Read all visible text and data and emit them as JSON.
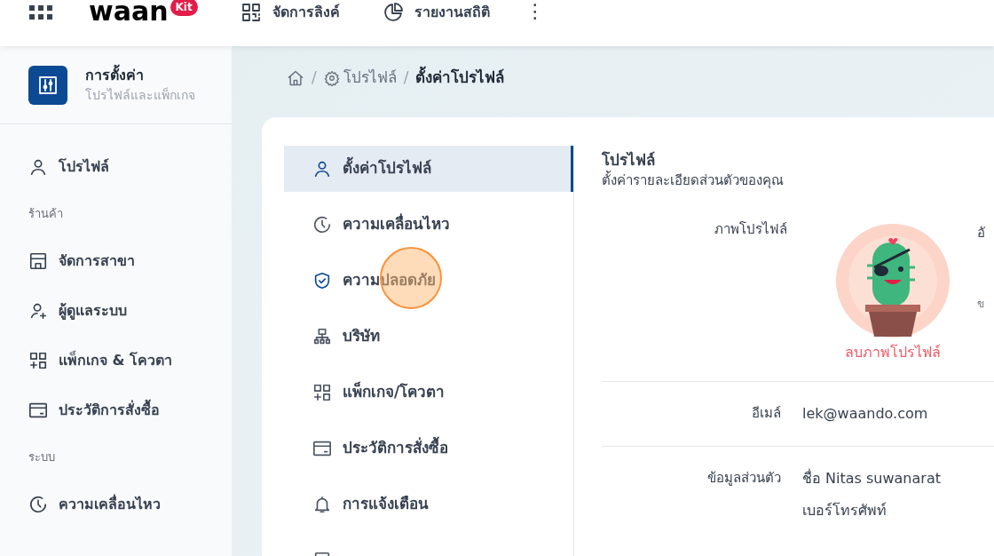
{
  "header": {
    "logo": "waan",
    "logo_badge": "Kit",
    "nav": [
      {
        "label": "จัดการลิงค์",
        "kind": "qr"
      },
      {
        "label": "รายงานสถิติ",
        "kind": "pie"
      }
    ],
    "more": "⋮"
  },
  "sidebar": {
    "title": "การตั้งค่า",
    "subtitle": "โปรไฟล์และแพ็กเกจ",
    "items": [
      {
        "kind": "user",
        "label": "โปรไฟล์"
      },
      {
        "kind": "section",
        "label": "ร้านค้า"
      },
      {
        "kind": "store",
        "label": "จัดการสาขา"
      },
      {
        "kind": "user-plus",
        "label": "ผู้ดูแลระบบ"
      },
      {
        "kind": "grid-plus",
        "label": "แพ็กเกจ & โควตา"
      },
      {
        "kind": "card",
        "label": "ประวัติการสั่งซื้อ"
      },
      {
        "kind": "section",
        "label": "ระบบ"
      },
      {
        "kind": "clock",
        "label": "ความเคลื่อนไหว"
      }
    ]
  },
  "breadcrumb": [
    {
      "kind": "separator",
      "label": "/"
    },
    {
      "kind": "gear",
      "label": "โปรไฟล์"
    },
    {
      "kind": "separator",
      "label": "/"
    },
    {
      "kind": "current",
      "label": "ตั้งค่าโปรไฟล์"
    }
  ],
  "settings_menu": [
    {
      "label": "ตั้งค่าโปรไฟล์",
      "kind": "user",
      "selected": true
    },
    {
      "label": "ความเคลื่อนไหว",
      "kind": "clock",
      "selected": false
    },
    {
      "label": "ความปลอดภัย",
      "kind": "shield",
      "selected": false
    },
    {
      "label": "บริษัท",
      "kind": "org",
      "selected": false
    },
    {
      "label": "แพ็กเกจ/โควตา",
      "kind": "grid-plus",
      "selected": false
    },
    {
      "label": "ประวัติการสั่งซื้อ",
      "kind": "card",
      "selected": false
    },
    {
      "label": "การแจ้งเตือน",
      "kind": "bell",
      "selected": false
    },
    {
      "kind": "doc",
      "selected": false
    }
  ],
  "profile": {
    "title": "โปรไฟล์",
    "subtitle": "ตั้งค่ารายละเอียดส่วนตัวของคุณ",
    "photo_label": "ภาพโปรไฟล์",
    "remove_photo": "ลบภาพโปรไฟล์",
    "upload_label": "อั",
    "upload_hint": "ข",
    "fields": [
      {
        "label": "อีเมล์",
        "values": [
          "lek@waando.com"
        ]
      },
      {
        "label": "ข้อมูลส่วนตัว",
        "values": [
          "ชื่อ Nitas suwanarat",
          "เบอร์โทรศัพท์"
        ]
      }
    ]
  }
}
